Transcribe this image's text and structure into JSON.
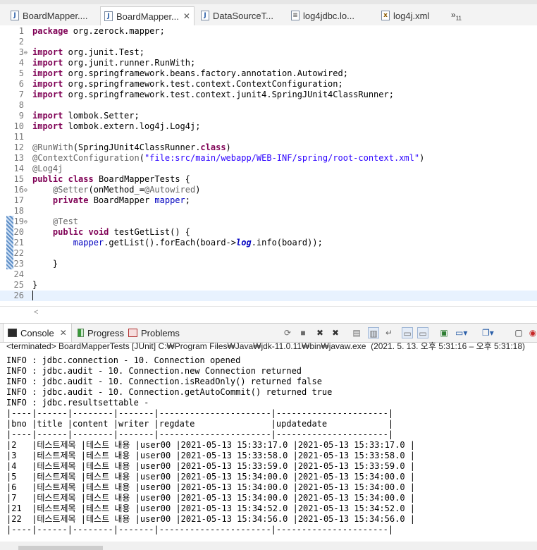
{
  "editor_tabs": [
    {
      "label": "BoardMapper....",
      "icon": "J",
      "close": "✕",
      "active": false
    },
    {
      "label": "BoardMapper...",
      "icon": "J",
      "close": "✕",
      "active": true
    },
    {
      "label": "DataSourceT...",
      "icon": "J",
      "close": "",
      "active": false
    },
    {
      "label": "log4jdbc.lo...",
      "icon": "≡",
      "close": "",
      "active": false
    },
    {
      "label": "log4j.xml",
      "icon": "x",
      "close": "",
      "active": false
    }
  ],
  "tab_overflow": {
    "glyph": "»",
    "count": "11"
  },
  "code_lines": [
    {
      "n": "1",
      "segs": [
        {
          "t": "package",
          "c": "kw"
        },
        {
          "t": " org.zerock.mapper;",
          "c": ""
        }
      ]
    },
    {
      "n": "2",
      "segs": []
    },
    {
      "n": "3",
      "fold": "⊖",
      "segs": [
        {
          "t": "import",
          "c": "kw"
        },
        {
          "t": " org.junit.Test;",
          "c": ""
        }
      ]
    },
    {
      "n": "4",
      "segs": [
        {
          "t": "import",
          "c": "kw"
        },
        {
          "t": " org.junit.runner.RunWith;",
          "c": ""
        }
      ]
    },
    {
      "n": "5",
      "segs": [
        {
          "t": "import",
          "c": "kw"
        },
        {
          "t": " org.springframework.beans.factory.annotation.Autowired;",
          "c": ""
        }
      ]
    },
    {
      "n": "6",
      "segs": [
        {
          "t": "import",
          "c": "kw"
        },
        {
          "t": " org.springframework.test.context.ContextConfiguration;",
          "c": ""
        }
      ]
    },
    {
      "n": "7",
      "segs": [
        {
          "t": "import",
          "c": "kw"
        },
        {
          "t": " org.springframework.test.context.junit4.SpringJUnit4ClassRunner;",
          "c": ""
        }
      ]
    },
    {
      "n": "8",
      "segs": []
    },
    {
      "n": "9",
      "segs": [
        {
          "t": "import",
          "c": "kw"
        },
        {
          "t": " lombok.Setter;",
          "c": ""
        }
      ]
    },
    {
      "n": "10",
      "segs": [
        {
          "t": "import",
          "c": "kw"
        },
        {
          "t": " lombok.extern.log4j.Log4j;",
          "c": ""
        }
      ]
    },
    {
      "n": "11",
      "segs": []
    },
    {
      "n": "12",
      "segs": [
        {
          "t": "@RunWith",
          "c": "ann"
        },
        {
          "t": "(SpringJUnit4ClassRunner.",
          "c": ""
        },
        {
          "t": "class",
          "c": "kw"
        },
        {
          "t": ")",
          "c": ""
        }
      ]
    },
    {
      "n": "13",
      "segs": [
        {
          "t": "@ContextConfiguration",
          "c": "ann"
        },
        {
          "t": "(",
          "c": ""
        },
        {
          "t": "\"file:src/main/webapp/WEB-INF/spring/root-context.xml\"",
          "c": "str"
        },
        {
          "t": ")",
          "c": ""
        }
      ]
    },
    {
      "n": "14",
      "segs": [
        {
          "t": "@Log4j",
          "c": "ann"
        }
      ]
    },
    {
      "n": "15",
      "segs": [
        {
          "t": "public",
          "c": "kw"
        },
        {
          "t": " ",
          "c": ""
        },
        {
          "t": "class",
          "c": "kw"
        },
        {
          "t": " BoardMapperTests {",
          "c": ""
        }
      ]
    },
    {
      "n": "16",
      "fold": "⊖",
      "segs": [
        {
          "t": "    ",
          "c": ""
        },
        {
          "t": "@Setter",
          "c": "ann"
        },
        {
          "t": "(onMethod_=",
          "c": ""
        },
        {
          "t": "@Autowired",
          "c": "ann"
        },
        {
          "t": ")",
          "c": ""
        }
      ]
    },
    {
      "n": "17",
      "segs": [
        {
          "t": "    ",
          "c": ""
        },
        {
          "t": "private",
          "c": "kw"
        },
        {
          "t": " BoardMapper ",
          "c": ""
        },
        {
          "t": "mapper",
          "c": "fld"
        },
        {
          "t": ";",
          "c": ""
        }
      ]
    },
    {
      "n": "18",
      "segs": []
    },
    {
      "n": "19",
      "fold": "⊖",
      "segs": [
        {
          "t": "    ",
          "c": ""
        },
        {
          "t": "@Test",
          "c": "ann"
        }
      ]
    },
    {
      "n": "20",
      "segs": [
        {
          "t": "    ",
          "c": ""
        },
        {
          "t": "public",
          "c": "kw"
        },
        {
          "t": " ",
          "c": ""
        },
        {
          "t": "void",
          "c": "kw"
        },
        {
          "t": " testGetList() {",
          "c": ""
        }
      ]
    },
    {
      "n": "21",
      "segs": [
        {
          "t": "        ",
          "c": ""
        },
        {
          "t": "mapper",
          "c": "fld"
        },
        {
          "t": ".getList().forEach(board->",
          "c": ""
        },
        {
          "t": "log",
          "c": "sfld"
        },
        {
          "t": ".info(board));",
          "c": ""
        }
      ]
    },
    {
      "n": "22",
      "segs": []
    },
    {
      "n": "23",
      "segs": [
        {
          "t": "    }",
          "c": ""
        }
      ]
    },
    {
      "n": "24",
      "segs": []
    },
    {
      "n": "25",
      "segs": [
        {
          "t": "}",
          "c": ""
        }
      ]
    },
    {
      "n": "26",
      "segs": [],
      "current": true
    }
  ],
  "hscroll_arrow": "<",
  "views": {
    "console": "Console",
    "progress": "Progress",
    "problems": "Problems",
    "close": "✕"
  },
  "terminated_line": "<terminated> BoardMapperTests [JUnit] C:₩Program Files₩Java₩jdk-11.0.11₩bin₩javaw.exe  (2021. 5. 13. 오후 5:31:16 – 오후 5:31:18)",
  "console_lines": [
    "INFO : jdbc.connection - 10. Connection opened",
    "INFO : jdbc.audit - 10. Connection.new Connection returned",
    "INFO : jdbc.audit - 10. Connection.isReadOnly() returned false",
    "INFO : jdbc.audit - 10. Connection.getAutoCommit() returned true",
    "INFO : jdbc.resultsettable -",
    "|----|------|--------|-------|----------------------|----------------------|",
    "|bno |title |content |writer |regdate               |updatedate            |",
    "|----|------|--------|-------|----------------------|----------------------|",
    "|2   |테스트제목 |테스트 내용 |user00 |2021-05-13 15:33:17.0 |2021-05-13 15:33:17.0 |",
    "|3   |테스트제목 |테스트 내용 |user00 |2021-05-13 15:33:58.0 |2021-05-13 15:33:58.0 |",
    "|4   |테스트제목 |테스트 내용 |user00 |2021-05-13 15:33:59.0 |2021-05-13 15:33:59.0 |",
    "|5   |테스트제목 |테스트 내용 |user00 |2021-05-13 15:34:00.0 |2021-05-13 15:34:00.0 |",
    "|6   |테스트제목 |테스트 내용 |user00 |2021-05-13 15:34:00.0 |2021-05-13 15:34:00.0 |",
    "|7   |테스트제목 |테스트 내용 |user00 |2021-05-13 15:34:00.0 |2021-05-13 15:34:00.0 |",
    "|21  |테스트제목 |테스트 내용 |user00 |2021-05-13 15:34:52.0 |2021-05-13 15:34:52.0 |",
    "|22  |테스트제목 |테스트 내용 |user00 |2021-05-13 15:34:56.0 |2021-05-13 15:34:56.0 |",
    "|----|------|--------|-------|----------------------|----------------------|"
  ],
  "toolbar_icons": [
    "remove-launch-icon",
    "terminate-icon",
    "remove-icon",
    "remove-all-icon",
    "clear-console-icon",
    "scroll-lock-icon",
    "word-wrap-icon",
    "show-on-stdout-icon",
    "show-on-stderr-icon",
    "pin-console-icon",
    "display-console-icon",
    "open-console-icon",
    "minimize-icon"
  ],
  "colors": {
    "keyword": "#7f0055",
    "annotation": "#646464",
    "string": "#2a00ff",
    "field": "#0000c0",
    "current_line": "#e8f2fe"
  }
}
